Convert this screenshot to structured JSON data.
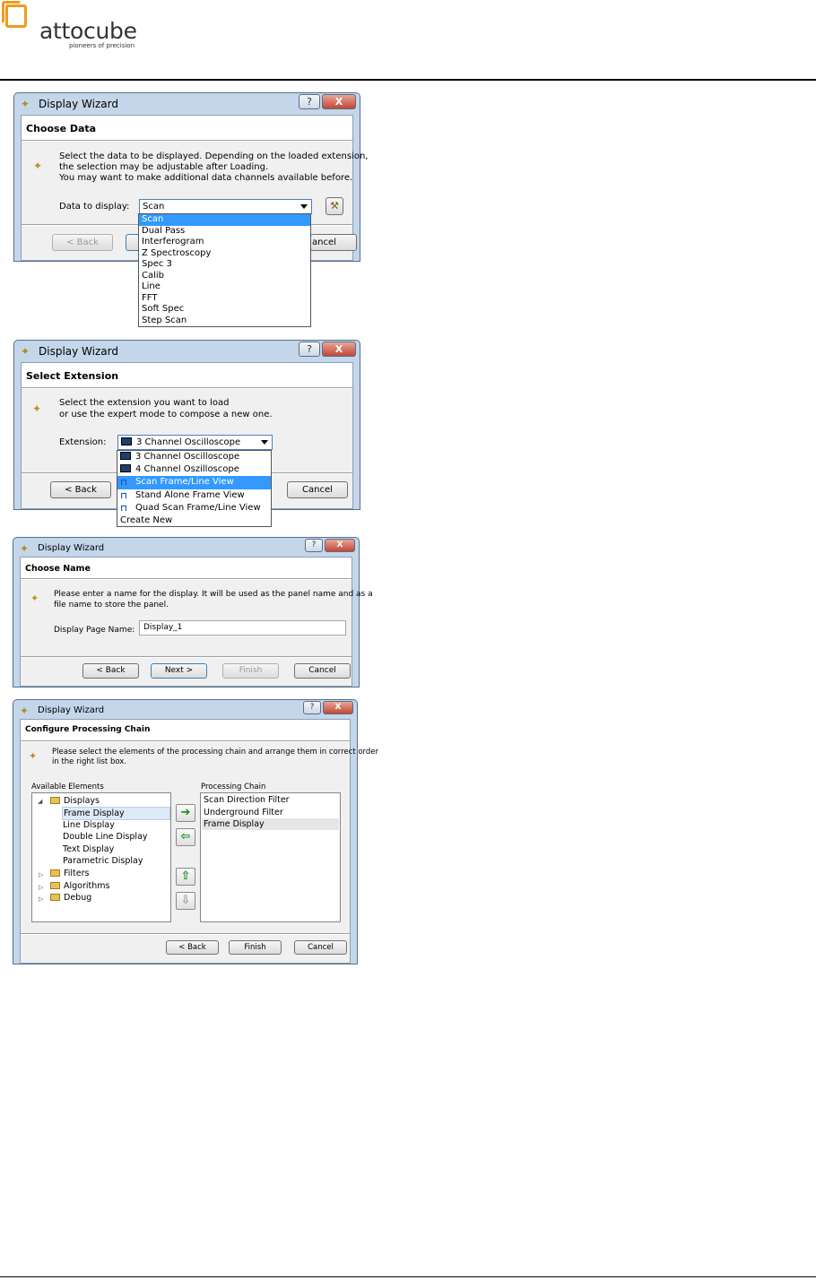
{
  "header": {
    "brand": "attocube",
    "tagline": "pioneers of precision"
  },
  "colors": {
    "brand_orange": "#f09a1f",
    "selection_blue": "#3399ff",
    "window_frame": "#c4d6ea",
    "close_red": "#c14734"
  },
  "window": {
    "title": "Display Wizard",
    "help_label": "?",
    "close_label": "X"
  },
  "dialog1": {
    "heading": "Choose Data",
    "desc": [
      "Select the data to be displayed. Depending on the loaded extension,",
      "the selection may be adjustable after Loading.",
      "You may want to make additional data channels available before."
    ],
    "field_label": "Data to display:",
    "combo_value": "Scan",
    "options": [
      "Scan",
      "Dual Pass",
      "Interferogram",
      "Z Spectroscopy",
      "Spec 3",
      "Calib",
      "Line",
      "FFT",
      "Soft Spec",
      "Step Scan"
    ],
    "selected_index": 0,
    "back": "< Back",
    "cancel_partial": "ancel"
  },
  "dialog2": {
    "heading": "Select Extension",
    "desc": [
      "Select the extension you want to load",
      "or use the expert mode to compose a new one."
    ],
    "field_label": "Extension:",
    "combo_value": "3 Channel Oscilloscope",
    "options": [
      {
        "label": "3 Channel Oscilloscope",
        "icon": "oscilloscope-icon"
      },
      {
        "label": "4 Channel Oszilloscope",
        "icon": "oscilloscope-icon"
      },
      {
        "label": "Scan Frame/Line View",
        "icon": "scan-view-icon"
      },
      {
        "label": "Stand Alone Frame View",
        "icon": "scan-view-icon"
      },
      {
        "label": "Quad Scan Frame/Line View",
        "icon": "scan-view-icon"
      },
      {
        "label": "Create New",
        "icon": ""
      }
    ],
    "selected_index": 2,
    "back": "< Back",
    "cancel": "Cancel"
  },
  "dialog3": {
    "heading": "Choose Name",
    "desc": [
      "Please enter a name for the display. It will be used as the panel name and as a",
      "file name to store the panel."
    ],
    "field_label": "Display Page Name:",
    "field_value": "Display_1",
    "back": "< Back",
    "next": "Next >",
    "finish": "Finish",
    "cancel": "Cancel"
  },
  "dialog4": {
    "heading": "Configure Processing Chain",
    "desc": [
      "Please select the elements of the processing chain and arrange them in correct order",
      "in the right list box."
    ],
    "available_label": "Available Elements",
    "chain_label": "Processing Chain",
    "tree": {
      "displays": "Displays",
      "display_children": [
        "Frame Display",
        "Line Display",
        "Double Line Display",
        "Text Display",
        "Parametric Display"
      ],
      "others": [
        "Filters",
        "Algorithms",
        "Debug"
      ]
    },
    "chain": [
      "Scan Direction Filter",
      "Underground Filter",
      "Frame Display"
    ],
    "back": "< Back",
    "finish": "Finish",
    "cancel": "Cancel"
  }
}
